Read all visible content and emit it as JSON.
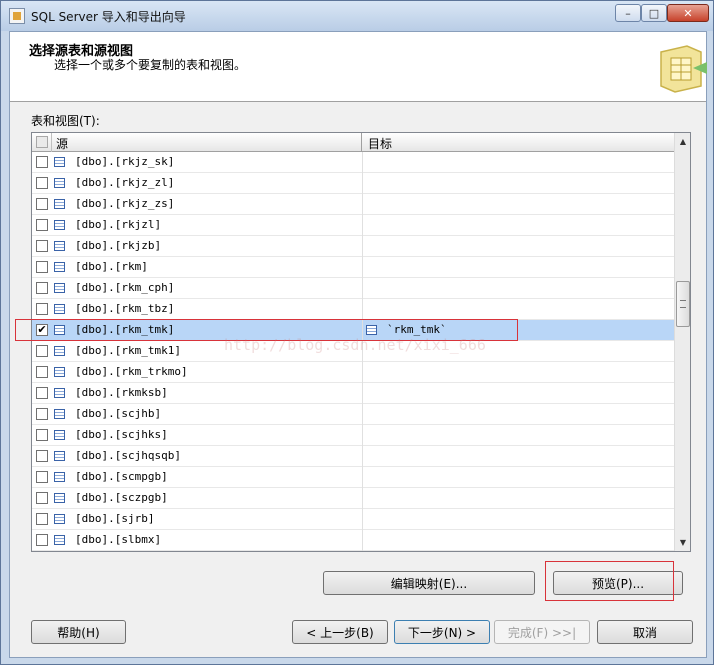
{
  "window": {
    "title": "SQL Server 导入和导出向导",
    "controls": {
      "minimize": "–",
      "maximize": "□",
      "close": "✕"
    }
  },
  "header": {
    "title": "选择源表和源视图",
    "subtitle": "选择一个或多个要复制的表和视图。"
  },
  "list_label": "表和视图(T):",
  "grid": {
    "columns": {
      "source": "源",
      "target": "目标"
    },
    "rows": [
      {
        "source": "[dbo].[rkjz_sk]",
        "target": "",
        "checked": false
      },
      {
        "source": "[dbo].[rkjz_zl]",
        "target": "",
        "checked": false
      },
      {
        "source": "[dbo].[rkjz_zs]",
        "target": "",
        "checked": false
      },
      {
        "source": "[dbo].[rkjzl]",
        "target": "",
        "checked": false
      },
      {
        "source": "[dbo].[rkjzb]",
        "target": "",
        "checked": false
      },
      {
        "source": "[dbo].[rkm]",
        "target": "",
        "checked": false
      },
      {
        "source": "[dbo].[rkm_cph]",
        "target": "",
        "checked": false
      },
      {
        "source": "[dbo].[rkm_tbz]",
        "target": "",
        "checked": false
      },
      {
        "source": "[dbo].[rkm_tmk]",
        "target": "`rkm_tmk`",
        "checked": true
      },
      {
        "source": "[dbo].[rkm_tmk1]",
        "target": "",
        "checked": false
      },
      {
        "source": "[dbo].[rkm_trkmo]",
        "target": "",
        "checked": false
      },
      {
        "source": "[dbo].[rkmksb]",
        "target": "",
        "checked": false
      },
      {
        "source": "[dbo].[scjhb]",
        "target": "",
        "checked": false
      },
      {
        "source": "[dbo].[scjhks]",
        "target": "",
        "checked": false
      },
      {
        "source": "[dbo].[scjhqsqb]",
        "target": "",
        "checked": false
      },
      {
        "source": "[dbo].[scmpgb]",
        "target": "",
        "checked": false
      },
      {
        "source": "[dbo].[sczpgb]",
        "target": "",
        "checked": false
      },
      {
        "source": "[dbo].[sjrb]",
        "target": "",
        "checked": false
      },
      {
        "source": "[dbo].[slbmx]",
        "target": "",
        "checked": false
      }
    ]
  },
  "buttons": {
    "edit_mapping": "编辑映射(E)...",
    "preview": "预览(P)...",
    "help": "帮助(H)",
    "back": "< 上一步(B)",
    "next": "下一步(N) >",
    "finish": "完成(F) >>|",
    "cancel": "取消"
  },
  "watermark": "http://blog.csdn.net/xixi_666",
  "colors": {
    "selected_row": "#b9d6f7",
    "highlight_box": "#d8333a",
    "titlebar": "#c9d8ea"
  }
}
